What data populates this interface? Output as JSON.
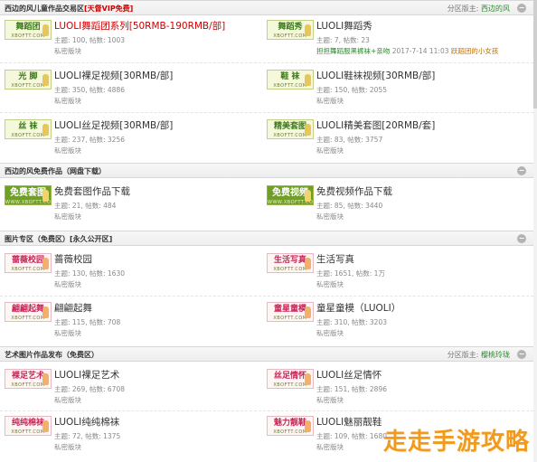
{
  "sections": [
    {
      "title": "西边的风儿童作品交易区",
      "title_vip": "[天督VIP免费]",
      "moderator_label": "分区版主:",
      "moderator_name": "西边的风",
      "forums": [
        {
          "logo": "舞蹈团",
          "logo_sub": "XBOFTT.COM",
          "name": "LUOLI舞蹈团系列[50RMB-190RMB/部]",
          "stats": "主题: 100, 帖数: 1003",
          "private": "私密版块"
        },
        {
          "logo": "舞蹈秀",
          "logo_sub": "XBOFTT.COM",
          "name": "LUOLI舞蹈秀",
          "stats": "主题: 7, 帖数: 23",
          "lastpost_link": "担担舞蹈服黑裤袜+亲吻",
          "lastpost_time": "2017-7-14 11:03",
          "lastpost_user": "跃蹈团的小女孩"
        },
        {
          "logo": "光 脚",
          "logo_sub": "XBOFTT.COM",
          "name": "LUOLI裸足视频[30RMB/部]",
          "stats": "主题: 350, 帖数: 4886",
          "private": "私密版块"
        },
        {
          "logo": "鞋 袜",
          "logo_sub": "XBOFTT.COM",
          "name": "LUOLI鞋袜视频[30RMB/部]",
          "stats": "主题: 150, 帖数: 2055",
          "private": "私密版块"
        },
        {
          "logo": "丝 袜",
          "logo_sub": "XBOFTT.COM",
          "name": "LUOLI丝足视频[30RMB/部]",
          "stats": "主题: 237, 帖数: 3256",
          "private": "私密版块"
        },
        {
          "logo": "精美套图",
          "logo_sub": "XBOFTT.COM",
          "name": "LUOLI精美套图[20RMB/套]",
          "stats": "主题: 83, 帖数: 3757",
          "private": "私密版块"
        }
      ]
    },
    {
      "title": "西边的风免费作品（网盘下载）",
      "forums": [
        {
          "logo": "免费套图",
          "logo_sub": "WWW.XBOFTT.COM",
          "name": "免费套图作品下载",
          "stats": "主题: 21, 帖数: 484",
          "private": "私密版块"
        },
        {
          "logo": "免费视频",
          "logo_sub": "WWW.XBOFTT.COM",
          "name": "免费视频作品下载",
          "stats": "主题: 85, 帖数: 3440",
          "private": "私密版块"
        }
      ]
    },
    {
      "title": "图片专区（免费区）[永久公开区]",
      "forums": [
        {
          "logo": "蔷薇校园",
          "logo_sub": "XBOFTT.COM",
          "name": "蔷薇校园",
          "stats": "主题: 130, 帖数: 1630",
          "private": "私密版块"
        },
        {
          "logo": "生活写真",
          "logo_sub": "XBOFTT.COM",
          "name": "生活写真",
          "stats": "主题: 1651, 帖数: 1万",
          "private": "私密版块"
        },
        {
          "logo": "翩翩起舞",
          "logo_sub": "XBOFTT.COM",
          "name": "翩翩起舞",
          "stats": "主题: 115, 帖数: 708",
          "private": "私密版块"
        },
        {
          "logo": "童星童模",
          "logo_sub": "XBOFTT.COM",
          "name": "童星童模（LUOLI）",
          "stats": "主题: 310, 帖数: 3203",
          "private": "私密版块"
        }
      ]
    },
    {
      "title": "艺术图片作品发布（免费区）",
      "moderator_label": "分区版主:",
      "moderator_name": "樱桃玲珑",
      "forums": [
        {
          "logo": "裸足艺术",
          "logo_sub": "XBOFTT.COM",
          "name": "LUOLI裸足艺术",
          "stats": "主题: 269, 帖数: 6708",
          "private": "私密版块"
        },
        {
          "logo": "丝足情怀",
          "logo_sub": "XBOFTT.COM",
          "name": "LUOLI丝足情怀",
          "stats": "主题: 151, 帖数: 2896",
          "private": "私密版块"
        },
        {
          "logo": "纯纯棉袜",
          "logo_sub": "XBOFTT.COM",
          "name": "LUOLI纯纯棉袜",
          "stats": "主题: 72, 帖数: 1375",
          "private": "私密版块"
        },
        {
          "logo": "魅力靓鞋",
          "logo_sub": "XBOFTT.COM",
          "name": "LUOLI魅丽靓鞋",
          "stats": "主题: 109, 帖数: 1680",
          "private": "私密版块"
        }
      ]
    }
  ],
  "collapse_symbol": "−",
  "watermark": "走走手游攻略",
  "colors": {
    "vip_red": "#cc0000",
    "moderator_green": "#2a8a2a",
    "watermark_orange": "#f19a1d"
  }
}
